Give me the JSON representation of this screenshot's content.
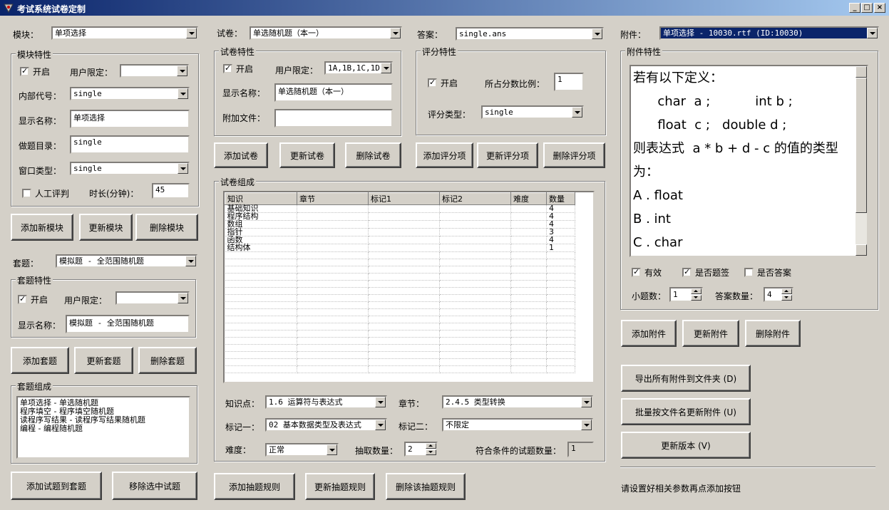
{
  "window": {
    "title": "考试系统试卷定制"
  },
  "module": {
    "label": "模块：",
    "value": "单项选择",
    "group_title": "模块特性",
    "enable_label": "开启",
    "user_limit_label": "用户限定：",
    "user_limit_value": "",
    "internal_code_label": "内部代号：",
    "internal_code_value": "single",
    "display_name_label": "显示名称：",
    "display_name_value": "单项选择",
    "dir_label": "做题目录：",
    "dir_value": "single",
    "window_type_label": "窗口类型：",
    "window_type_value": "single",
    "manual_label": "人工评判",
    "duration_label": "时长(分钟)：",
    "duration_value": "45",
    "add_btn": "添加新模块",
    "update_btn": "更新模块",
    "delete_btn": "删除模块"
  },
  "set": {
    "label": "套题：",
    "value": "模拟题 - 全范围随机题",
    "group_title": "套题特性",
    "enable_label": "开启",
    "user_limit_label": "用户限定：",
    "user_limit_value": "",
    "display_name_label": "显示名称：",
    "display_name_value": "模拟题 - 全范围随机题",
    "add_btn": "添加套题",
    "update_btn": "更新套题",
    "delete_btn": "删除套题",
    "composition_title": "套题组成",
    "composition": [
      "单项选择 - 单选随机题",
      "程序填空 - 程序填空随机题",
      "读程序写结果 - 读程序写结果随机题",
      "编程 - 编程随机题"
    ],
    "add_question_btn": "添加试题到套题",
    "remove_question_btn": "移除选中试题"
  },
  "paper": {
    "label": "试卷：",
    "value": "单选随机题（本一）",
    "group_title": "试卷特性",
    "enable_label": "开启",
    "user_limit_label": "用户限定：",
    "user_limit_value": "1A,1B,1C,1D,",
    "display_name_label": "显示名称：",
    "display_name_value": "单选随机题（本一）",
    "attach_label": "附加文件：",
    "attach_value": "",
    "add_btn": "添加试卷",
    "update_btn": "更新试卷",
    "delete_btn": "删除试卷"
  },
  "answer": {
    "label": "答案：",
    "value": "single.ans",
    "group_title": "评分特性",
    "enable_label": "开启",
    "ratio_label": "所占分数比例：",
    "ratio_value": "1",
    "score_type_label": "评分类型：",
    "score_type_value": "single",
    "add_btn": "添加评分项",
    "update_btn": "更新评分项",
    "delete_btn": "删除评分项"
  },
  "composition": {
    "group_title": "试卷组成",
    "columns": [
      "知识",
      "章节",
      "标记1",
      "标记2",
      "难度",
      "数量"
    ],
    "rows": [
      [
        "基础知识",
        "",
        "",
        "",
        "",
        "4"
      ],
      [
        "程序结构",
        "",
        "",
        "",
        "",
        "4"
      ],
      [
        "数组",
        "",
        "",
        "",
        "",
        "4"
      ],
      [
        "指针",
        "",
        "",
        "",
        "",
        "3"
      ],
      [
        "函数",
        "",
        "",
        "",
        "",
        "4"
      ],
      [
        "结构体",
        "",
        "",
        "",
        "",
        "1"
      ]
    ],
    "knowledge_label": "知识点：",
    "knowledge_value": "1.6 运算符与表达式",
    "chapter_label": "章节：",
    "chapter_value": "2.4.5 类型转换",
    "mark1_label": "标记一：",
    "mark1_value": "02 基本数据类型及表达式",
    "mark2_label": "标记二：",
    "mark2_value": "不限定",
    "difficulty_label": "难度：",
    "difficulty_value": "正常",
    "draw_count_label": "抽取数量：",
    "draw_count_value": "2",
    "match_count_label": "符合条件的试题数量：",
    "match_count_value": "1",
    "add_rule_btn": "添加抽题规则",
    "update_rule_btn": "更新抽题规则",
    "delete_rule_btn": "删除该抽题规则"
  },
  "attachment": {
    "label": "附件：",
    "value": "单项选择 - 10030.rtf (ID:10030)",
    "group_title": "附件特性",
    "content": [
      "若有以下定义：",
      "      char  a ;           int b ;",
      "      float  c ;   double d ;",
      "则表达式  a * b + d - c 的值的类型",
      "为：",
      "A . float",
      "B . int",
      "C . char"
    ],
    "valid_label": "有效",
    "is_stem_label": "是否题签",
    "is_answer_label": "是否答案",
    "sub_count_label": "小题数：",
    "sub_count_value": "1",
    "answer_count_label": "答案数量：",
    "answer_count_value": "4",
    "add_btn": "添加附件",
    "update_btn": "更新附件",
    "delete_btn": "删除附件",
    "export_btn": "导出所有附件到文件夹 (D)",
    "batch_update_btn": "批量按文件名更新附件 (U)",
    "update_version_btn": "更新版本 (V)"
  },
  "status": {
    "text": "请设置好相关参数再点添加按钮"
  }
}
